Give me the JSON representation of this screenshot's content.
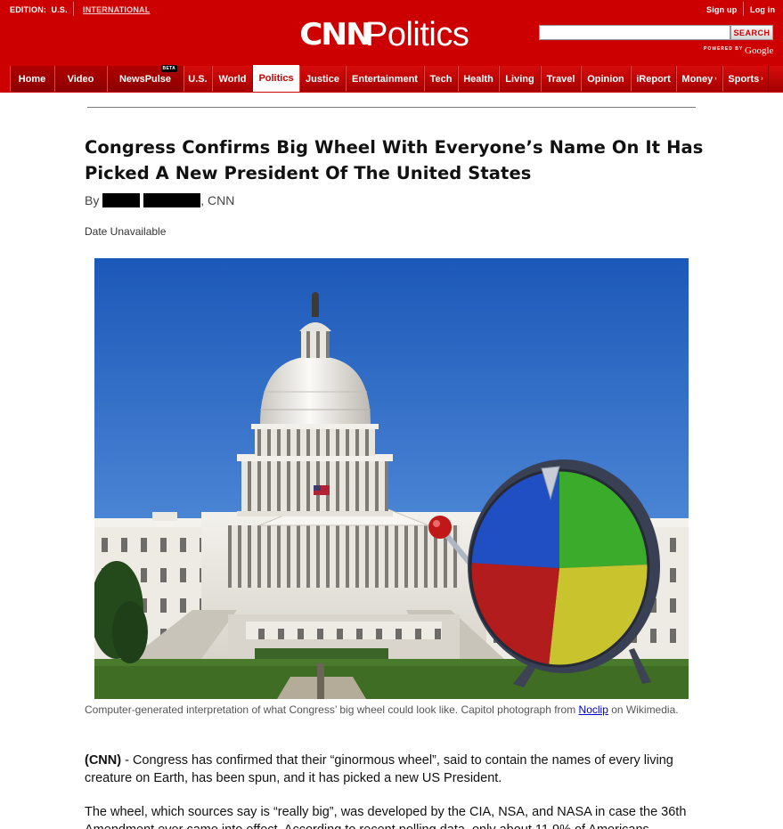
{
  "header": {
    "edition_label": "EDITION:",
    "edition_value": "U.S.",
    "edition_intl": "INTERNATIONAL",
    "signup": "Sign up",
    "login": "Log in",
    "logo_cnn": "CNN",
    "logo_section": "Politics",
    "search_button": "SEARCH",
    "search_value": "",
    "powered_by": "POWERED BY",
    "google": "Google"
  },
  "nav": {
    "items": [
      {
        "label": "Home"
      },
      {
        "label": "Video"
      },
      {
        "label": "NewsPulse",
        "badge": "BETA"
      },
      {
        "label": "U.S."
      },
      {
        "label": "World"
      },
      {
        "label": "Politics"
      },
      {
        "label": "Justice"
      },
      {
        "label": "Entertainment"
      },
      {
        "label": "Tech"
      },
      {
        "label": "Health"
      },
      {
        "label": "Living"
      },
      {
        "label": "Travel"
      },
      {
        "label": "Opinion"
      },
      {
        "label": "iReport"
      },
      {
        "label": "Money"
      },
      {
        "label": "Sports"
      }
    ],
    "arrow": "›"
  },
  "article": {
    "title": "Congress Confirms Big Wheel With Everyone’s Name On It Has Picked A New President Of The United States",
    "by_prefix": "By",
    "by_suffix": ", CNN",
    "date": "Date Unavailable",
    "caption_before": "Computer-generated interpretation of what Congress’ big wheel could look like. Capitol photograph from ",
    "caption_link": "Noclip",
    "caption_after": " on Wikimedia.",
    "p1_lead": "(CNN)",
    "p1_text": " - Congress has confirmed that their “ginormous wheel”, said to contain the names of every living creature on Earth, has been spun, and it has picked a new US President.",
    "p2_text": "The wheel, which sources say is “really big”, was developed by the CIA, NSA, and NASA in case the 36th Amendment ever came into effect. According to recent polling data, only about 11.9% of Americans"
  },
  "colors": {
    "brand_red": "#cc0000",
    "wheel_blue": "#1f4fc2",
    "wheel_green": "#3aab2a",
    "wheel_yellow": "#c9c42e",
    "wheel_red": "#b31c1c"
  }
}
